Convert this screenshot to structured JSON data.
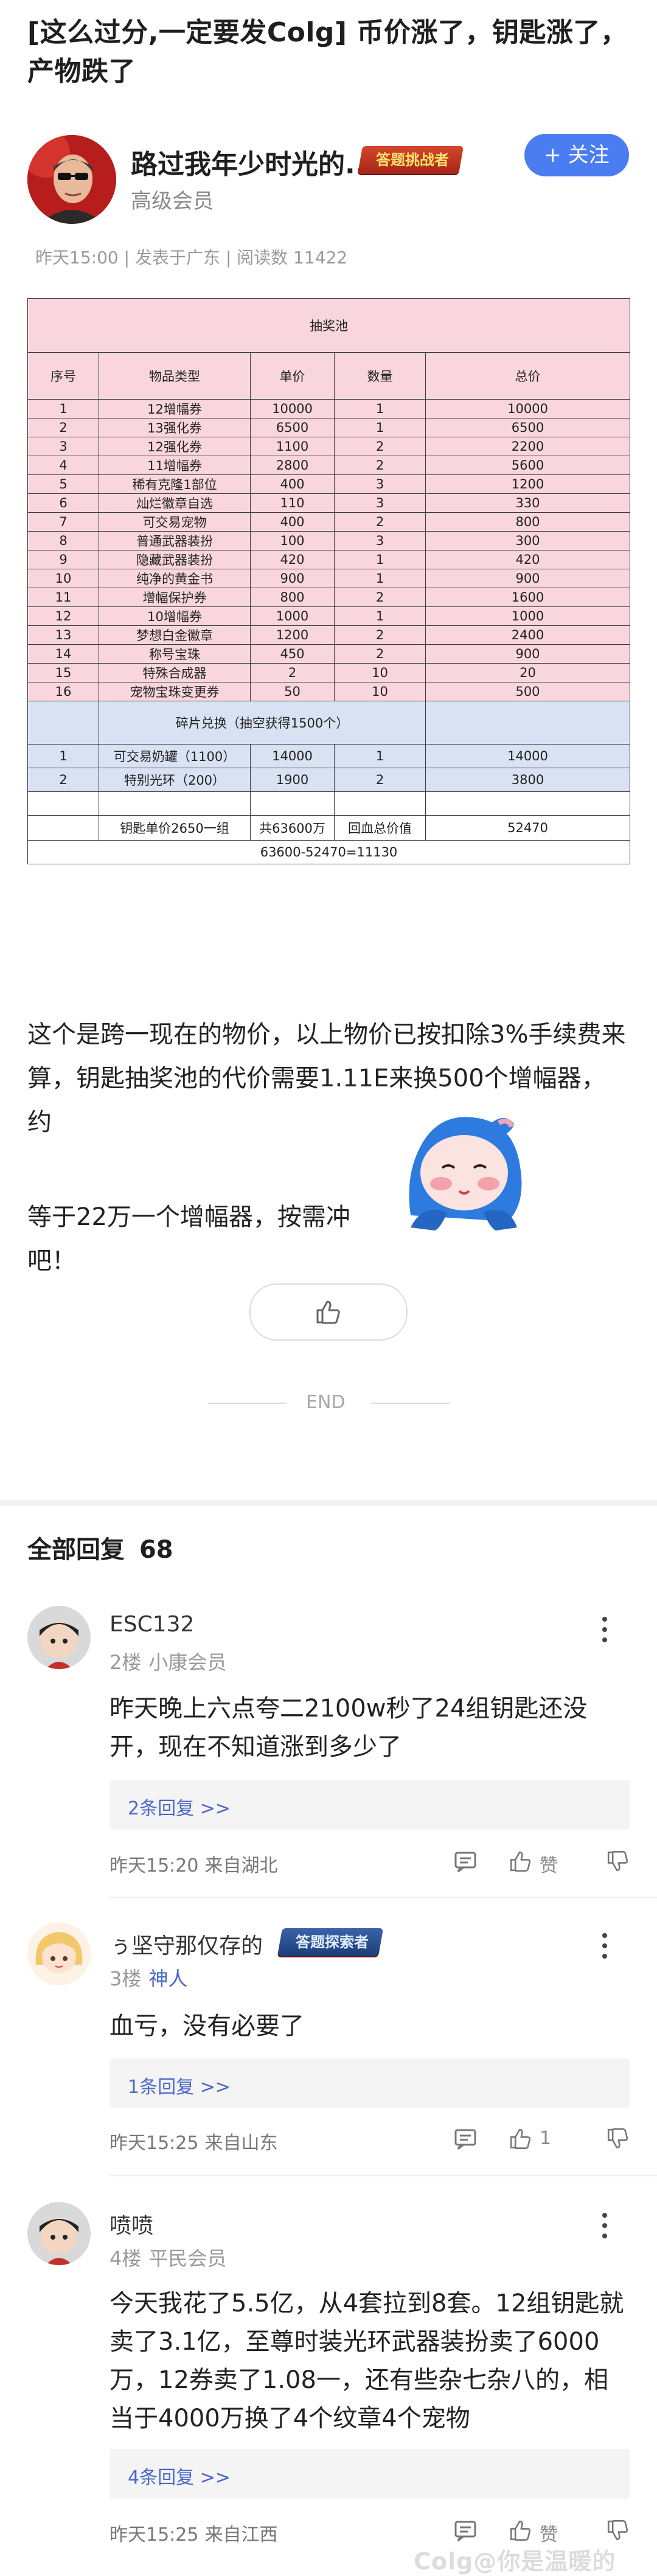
{
  "post": {
    "title": "[这么过分,一定要发Colg] 币价涨了，钥匙涨了，产物跌了",
    "author": {
      "name": "路过我年少时光的...",
      "badge": "答题挑战者",
      "level": "高级会员",
      "follow_label": "+ 关注"
    },
    "meta": "昨天15:00 | 发表于广东 | 阅读数 11422"
  },
  "table": {
    "title": "抽奖池",
    "headers": [
      "序号",
      "物品类型",
      "单价",
      "数量",
      "总价"
    ],
    "rows": [
      [
        "1",
        "12增幅券",
        "10000",
        "1",
        "10000"
      ],
      [
        "2",
        "13强化券",
        "6500",
        "1",
        "6500"
      ],
      [
        "3",
        "12强化券",
        "1100",
        "2",
        "2200"
      ],
      [
        "4",
        "11增幅券",
        "2800",
        "2",
        "5600"
      ],
      [
        "5",
        "稀有克隆1部位",
        "400",
        "3",
        "1200"
      ],
      [
        "6",
        "灿烂徽章自选",
        "110",
        "3",
        "330"
      ],
      [
        "7",
        "可交易宠物",
        "400",
        "2",
        "800"
      ],
      [
        "8",
        "普通武器装扮",
        "100",
        "3",
        "300"
      ],
      [
        "9",
        "隐藏武器装扮",
        "420",
        "1",
        "420"
      ],
      [
        "10",
        "纯净的黄金书",
        "900",
        "1",
        "900"
      ],
      [
        "11",
        "增幅保护券",
        "800",
        "2",
        "1600"
      ],
      [
        "12",
        "10增幅券",
        "1000",
        "1",
        "1000"
      ],
      [
        "13",
        "梦想白金徽章",
        "1200",
        "2",
        "2400"
      ],
      [
        "14",
        "称号宝珠",
        "450",
        "2",
        "900"
      ],
      [
        "15",
        "特殊合成器",
        "2",
        "10",
        "20"
      ],
      [
        "16",
        "宠物宝珠变更券",
        "50",
        "10",
        "500"
      ]
    ],
    "fragment_title": "碎片兑换（抽空获得1500个）",
    "fragment_rows": [
      [
        "1",
        "可交易奶罐（1100）",
        "14000",
        "1",
        "14000"
      ],
      [
        "2",
        "特别光环（200）",
        "1900",
        "2",
        "3800"
      ]
    ],
    "summary": {
      "key_price": "钥匙单价2650一组",
      "total_cost": "共63600万",
      "return_label": "回血总价值",
      "return_value": "52470",
      "formula": "63600-52470=11130"
    }
  },
  "body": {
    "paragraph1": "这个是跨一现在的物价，以上物价已按扣除3%手续费来算，钥匙抽奖池的代价需要1.11E来换500个增幅器，约",
    "paragraph2": "等于22万一个增幅器，按需冲吧！"
  },
  "end_label": "END",
  "replies": {
    "header": "全部回复",
    "count": "68",
    "items": [
      {
        "name": "ESC132",
        "floor": "2楼",
        "level": "小康会员",
        "text": "昨天晚上六点夸二2100w秒了24组钥匙还没开，现在不知道涨到多少了",
        "sub": "2条回复 >>",
        "time": "昨天15:20",
        "place": "来自湖北",
        "like": "赞"
      },
      {
        "name": "ぅ坚守那仅存的",
        "badge": "答题探索者",
        "floor": "3楼",
        "level": "神人",
        "text": "血亏，没有必要了",
        "sub": "1条回复 >>",
        "time": "昨天15:25",
        "place": "来自山东",
        "like": "1"
      },
      {
        "name": "喷喷",
        "floor": "4楼",
        "level": "平民会员",
        "text": "今天我花了5.5亿，从4套拉到8套。12组钥匙就卖了3.1亿，至尊时装光环武器装扮卖了6000万，12券卖了1.08一，还有些杂七杂八的，相当于4000万换了4个纹章4个宠物",
        "sub": "4条回复 >>",
        "time": "昨天15:25",
        "place": "来自江西",
        "like": "赞"
      }
    ]
  },
  "watermark": "Colg@你是温暖的"
}
